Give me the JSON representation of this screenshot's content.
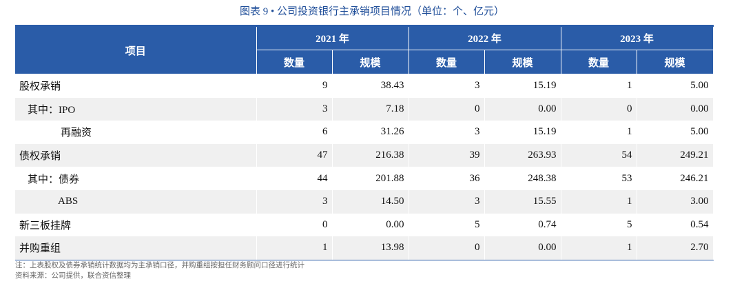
{
  "title": "图表 9 • 公司投资银行主承销项目情况（单位：个、亿元）",
  "header": {
    "project": "项目",
    "years": [
      "2021 年",
      "2022 年",
      "2023 年"
    ],
    "sub": [
      "数量",
      "规模",
      "数量",
      "规模",
      "数量",
      "规模"
    ]
  },
  "rows": [
    {
      "label": "股权承销",
      "values": [
        "9",
        "38.43",
        "3",
        "15.19",
        "1",
        "5.00"
      ]
    },
    {
      "label": "其中：IPO",
      "values": [
        "3",
        "7.18",
        "0",
        "0.00",
        "0",
        "0.00"
      ]
    },
    {
      "label": "再融资",
      "values": [
        "6",
        "31.26",
        "3",
        "15.19",
        "1",
        "5.00"
      ]
    },
    {
      "label": "债权承销",
      "values": [
        "47",
        "216.38",
        "39",
        "263.93",
        "54",
        "249.21"
      ]
    },
    {
      "label": "其中：债券",
      "values": [
        "44",
        "201.88",
        "36",
        "248.38",
        "53",
        "246.21"
      ]
    },
    {
      "label": "ABS",
      "values": [
        "3",
        "14.50",
        "3",
        "15.55",
        "1",
        "3.00"
      ]
    },
    {
      "label": "新三板挂牌",
      "values": [
        "0",
        "0.00",
        "5",
        "0.74",
        "5",
        "0.54"
      ]
    },
    {
      "label": "并购重组",
      "values": [
        "1",
        "13.98",
        "0",
        "0.00",
        "1",
        "2.70"
      ]
    }
  ],
  "notes": [
    "注：上表股权及债券承销统计数据均为主承销口径，并购重组按担任财务顾问口径进行统计",
    "资料来源：公司提供，联合资信整理"
  ]
}
